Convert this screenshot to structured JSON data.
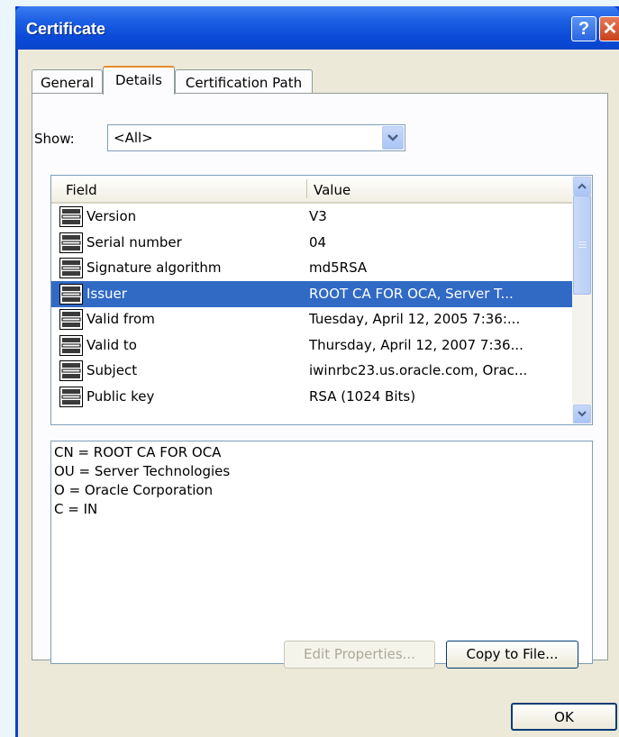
{
  "window": {
    "title": "Certificate",
    "help_label": "?",
    "close_label": "✕"
  },
  "tabs": [
    {
      "label": "General"
    },
    {
      "label": "Details"
    },
    {
      "label": "Certification Path"
    }
  ],
  "show": {
    "label": "Show:",
    "value": "<All>"
  },
  "list": {
    "columns": {
      "field": "Field",
      "value": "Value"
    },
    "rows": [
      {
        "field": "Version",
        "value": "V3"
      },
      {
        "field": "Serial number",
        "value": "04"
      },
      {
        "field": "Signature algorithm",
        "value": "md5RSA"
      },
      {
        "field": "Issuer",
        "value": "ROOT CA FOR OCA, Server T...",
        "selected": true
      },
      {
        "field": "Valid from",
        "value": "Tuesday, April 12, 2005 7:36:..."
      },
      {
        "field": "Valid to",
        "value": "Thursday, April 12, 2007 7:36..."
      },
      {
        "field": "Subject",
        "value": "iwinrbc23.us.oracle.com, Orac..."
      },
      {
        "field": "Public key",
        "value": "RSA (1024 Bits)"
      }
    ]
  },
  "details": {
    "lines": [
      "CN = ROOT CA FOR OCA",
      "OU = Server Technologies",
      "O = Oracle Corporation",
      "C = IN"
    ]
  },
  "buttons": {
    "edit_properties": "Edit Properties...",
    "copy_to_file": "Copy to File...",
    "ok": "OK"
  },
  "colors": {
    "selection": "#316ac5",
    "titlebar": "#0b4bd8",
    "tab_highlight": "#e68b2c"
  },
  "icons": {
    "field_icon": "certificate-field-icon"
  }
}
